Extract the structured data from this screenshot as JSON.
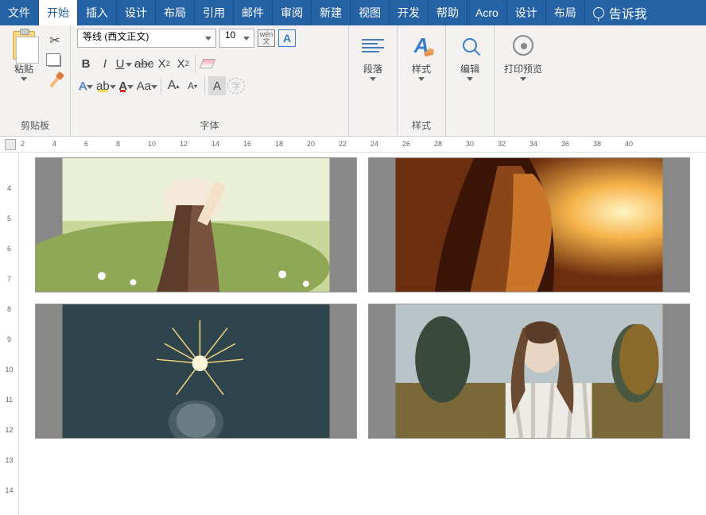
{
  "menu": {
    "tabs": [
      "文件",
      "开始",
      "插入",
      "设计",
      "布局",
      "引用",
      "邮件",
      "审阅",
      "新建",
      "视图",
      "开发",
      "帮助",
      "Acro",
      "设计",
      "布局"
    ],
    "active_index": 1,
    "tell_me": "告诉我"
  },
  "ribbon": {
    "clipboard": {
      "label": "剪贴板",
      "paste": "粘贴"
    },
    "font": {
      "label": "字体",
      "name": "等线 (西文正文)",
      "size": "10",
      "wen_top": "wén",
      "wen_char": "文"
    },
    "paragraph": {
      "label": "段落"
    },
    "styles": {
      "label": "样式",
      "button": "样式"
    },
    "edit": {
      "label": "编辑"
    },
    "preview": {
      "label": "打印预览"
    }
  },
  "ruler": {
    "h": [
      "2",
      "4",
      "6",
      "8",
      "10",
      "12",
      "14",
      "16",
      "18",
      "20",
      "22",
      "24",
      "26",
      "28",
      "30",
      "32",
      "34",
      "36",
      "38",
      "40"
    ],
    "v": [
      "",
      "4",
      "5",
      "6",
      "7",
      "8",
      "9",
      "10",
      "11",
      "12",
      "13",
      "14"
    ]
  }
}
